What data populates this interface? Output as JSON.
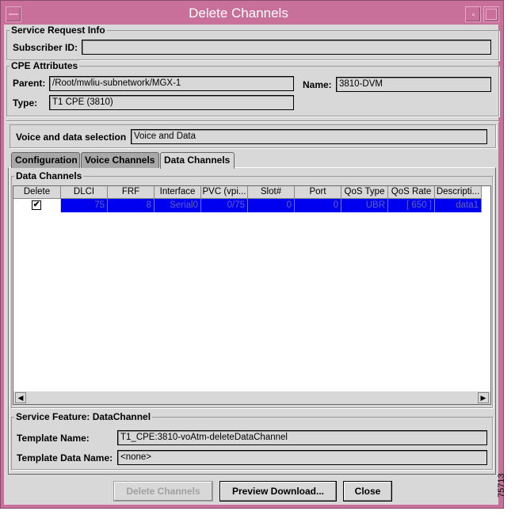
{
  "window": {
    "title": "Delete Channels"
  },
  "service_request": {
    "group_label": "Service Request Info",
    "subscriber_label": "Subscriber ID:",
    "subscriber_value": ""
  },
  "cpe": {
    "group_label": "CPE Attributes",
    "parent_label": "Parent:",
    "parent_value": "/Root/mwliu-subnetwork/MGX-1",
    "name_label": "Name:",
    "name_value": "3810-DVM",
    "type_label": "Type:",
    "type_value": "T1 CPE (3810)"
  },
  "selection": {
    "label": "Voice and data selection",
    "value": "Voice and Data"
  },
  "tabs": [
    {
      "label": "Configuration"
    },
    {
      "label": "Voice Channels"
    },
    {
      "label": "Data Channels",
      "selected": true
    }
  ],
  "data_channels": {
    "group_label": "Data Channels",
    "columns": [
      "Delete",
      "DLCI",
      "FRF",
      "Interface",
      "PVC (vpi...",
      "Slot#",
      "Port",
      "QoS Type",
      "QoS Rate",
      "Descripti..."
    ],
    "rows": [
      {
        "delete": true,
        "cells": [
          "75",
          "8",
          "Serial0",
          "0/75",
          "0",
          "0",
          "UBR",
          "[ 650 ]",
          "data1"
        ]
      }
    ]
  },
  "service_feature": {
    "group_label": "Service Feature: DataChannel",
    "template_name_label": "Template Name:",
    "template_name_value": "T1_CPE:3810-voAtm-deleteDataChannel",
    "template_data_label": "Template Data Name:",
    "template_data_value": "<none>"
  },
  "buttons": {
    "delete": "Delete Channels",
    "preview": "Preview Download...",
    "close": "Close"
  },
  "figure_id": "75713"
}
